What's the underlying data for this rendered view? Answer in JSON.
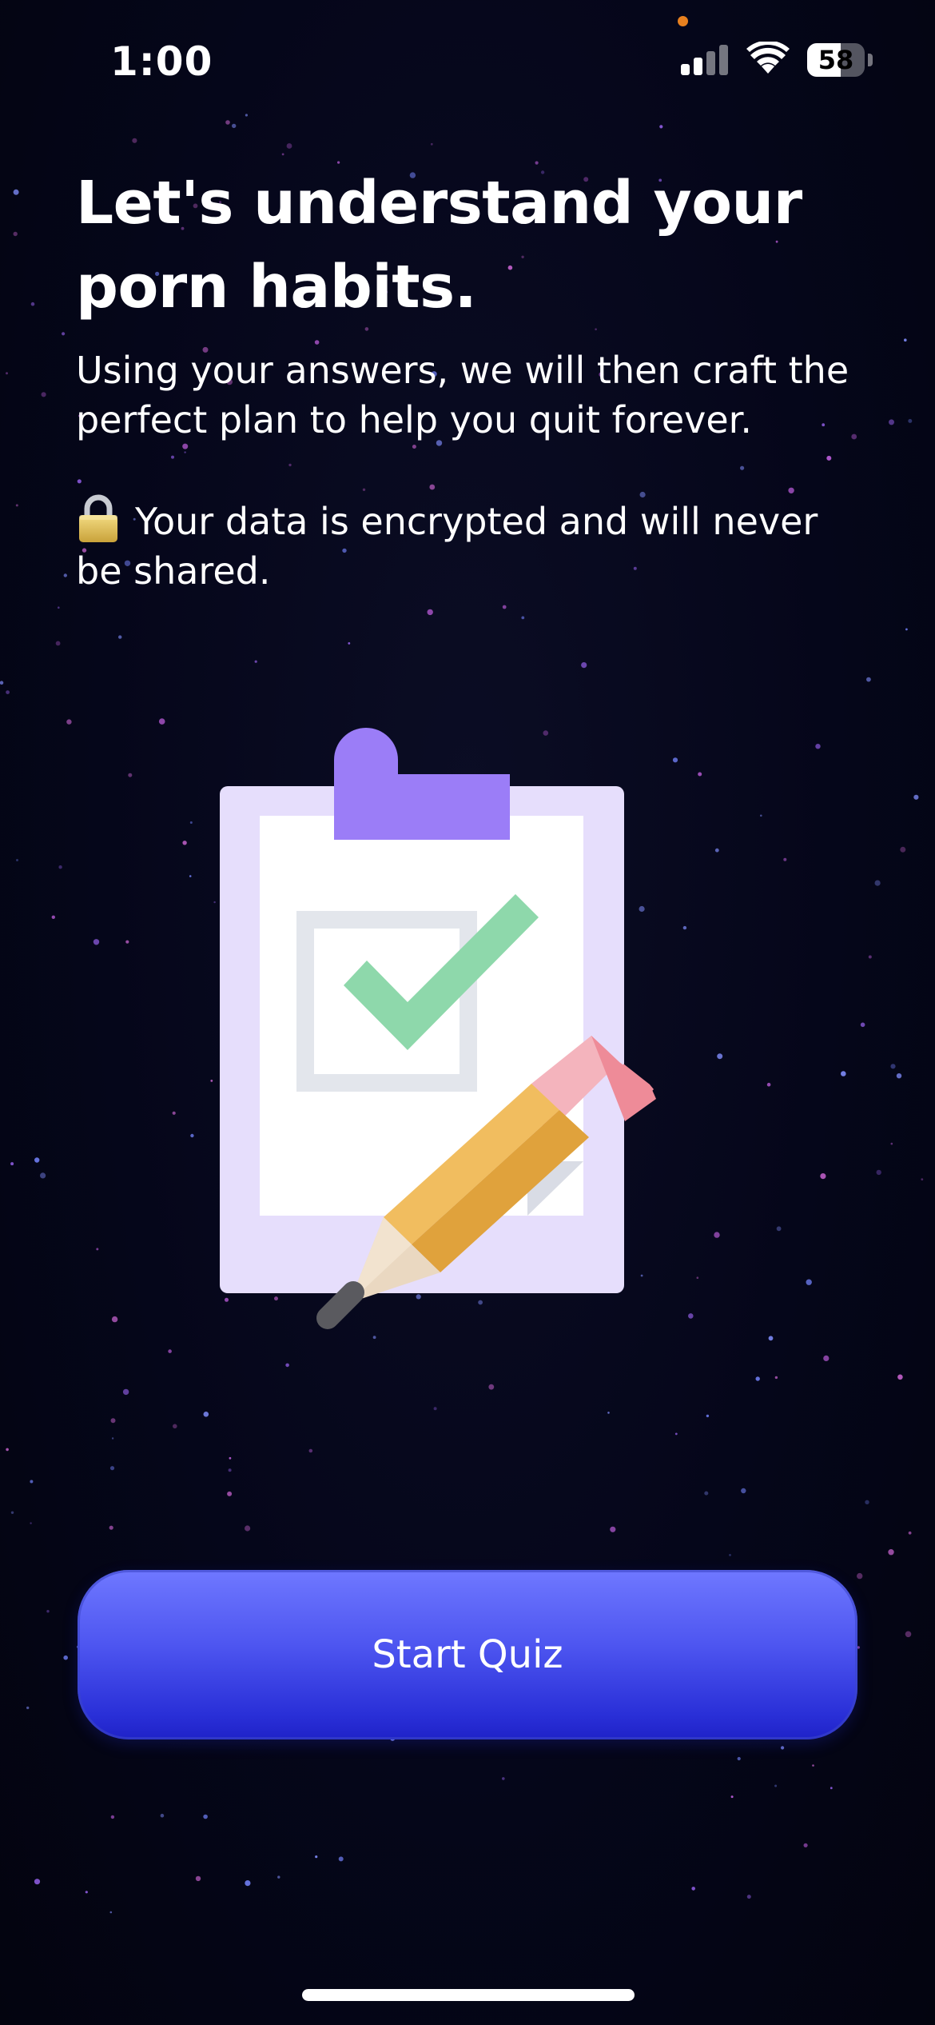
{
  "status_bar": {
    "time": "1:00",
    "battery_level": "58",
    "battery_fraction": 0.58,
    "privacy_dot_color": "#e8801f"
  },
  "content": {
    "title": "Let's understand your porn habits.",
    "subtitle": "Using your answers, we will then craft the perfect plan to help you quit forever.",
    "privacy_note": "Your data is encrypted and will never be shared."
  },
  "illustration": {
    "icons": [
      "clipboard-icon",
      "checkmark-icon",
      "pencil-icon"
    ],
    "colors": {
      "clipboard": "#e6defc",
      "clip": "#9b7df7",
      "check": "#8ed8ab",
      "pencil_body": "#f1bd5f",
      "eraser": "#f4b4bd"
    }
  },
  "actions": {
    "start_label": "Start Quiz"
  },
  "theme": {
    "accent_top": "#6f78ff",
    "accent_bottom": "#1f22c8",
    "background": "#05061a"
  }
}
